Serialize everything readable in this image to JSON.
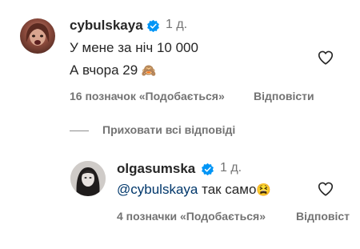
{
  "comment": {
    "username": "cybulskaya",
    "time": "1 д.",
    "line1": "У мене за ніч 10 000",
    "line2": "А вчора 29",
    "line2_emoji": "🙈",
    "likes": "16 позначок «Подобається»",
    "reply": "Відповісти"
  },
  "hide_replies": "Приховати всі відповіді",
  "reply_comment": {
    "username": "olgasumska",
    "time": "1 д.",
    "mention": "@cybulskaya",
    "text": "так само",
    "emoji": "😫",
    "likes": "4 позначки «Подобається»",
    "reply": "Відповіст"
  },
  "icons": {
    "verified": "verified-badge-icon",
    "like": "heart-outline-icon"
  },
  "colors": {
    "verified": "#0095f6",
    "mention": "#00376b",
    "secondary": "#737373"
  }
}
